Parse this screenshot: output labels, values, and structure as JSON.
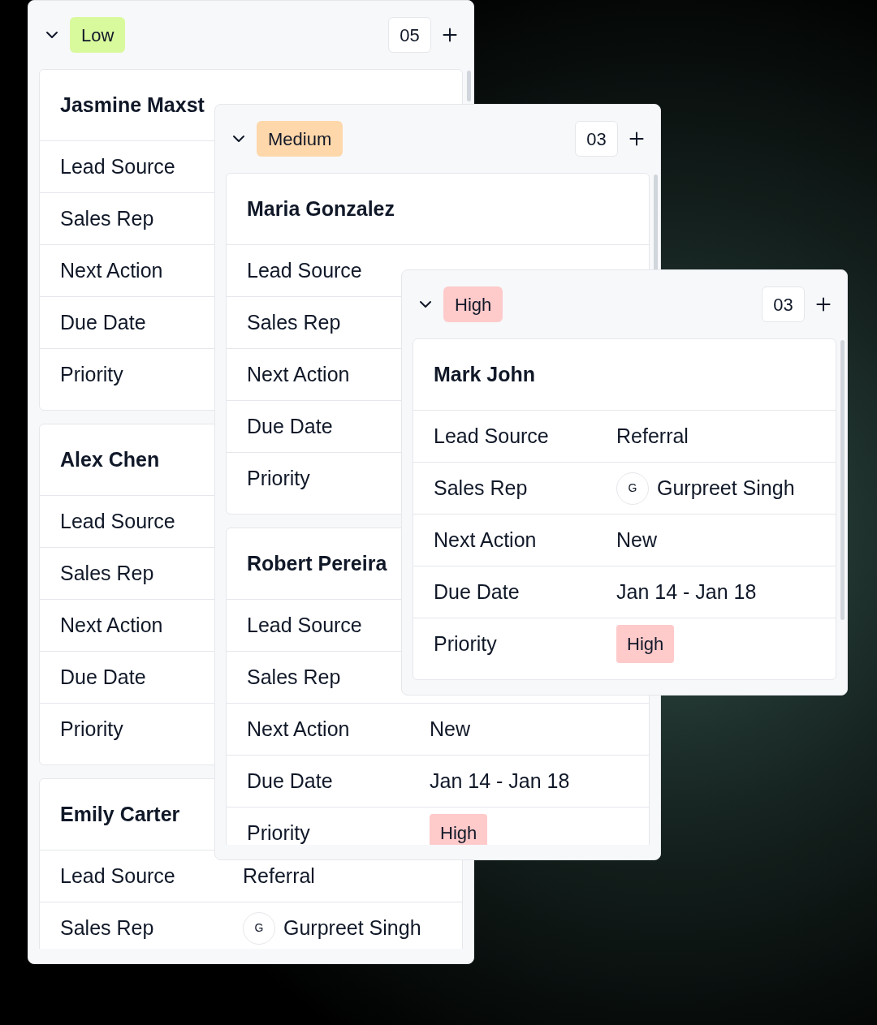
{
  "columns": [
    {
      "priority": "Low",
      "color": "#d9f99d",
      "expanded": true,
      "count": "05",
      "cards": [
        {
          "name": "Jasmine Maxst",
          "fields": [
            {
              "label": "Lead Source"
            },
            {
              "label": "Sales Rep"
            },
            {
              "label": "Next Action"
            },
            {
              "label": "Due Date"
            },
            {
              "label": "Priority"
            }
          ]
        },
        {
          "name": "Alex Chen",
          "fields": [
            {
              "label": "Lead Source"
            },
            {
              "label": "Sales Rep"
            },
            {
              "label": "Next Action"
            },
            {
              "label": "Due Date"
            },
            {
              "label": "Priority"
            }
          ]
        },
        {
          "name": "Emily Carter",
          "fields": [
            {
              "kind": "text",
              "label": "Lead Source",
              "value": "Referral"
            },
            {
              "kind": "person",
              "label": "Sales Rep",
              "initial": "G",
              "value": "Gurpreet Singh"
            }
          ]
        }
      ]
    },
    {
      "priority": "Medium",
      "color": "#fed7aa",
      "expanded": true,
      "count": "03",
      "cards": [
        {
          "name": "Maria Gonzalez",
          "fields": [
            {
              "label": "Lead Source"
            },
            {
              "label": "Sales Rep"
            },
            {
              "label": "Next Action"
            },
            {
              "label": "Due Date"
            },
            {
              "label": "Priority"
            }
          ]
        },
        {
          "name": "Robert Pereira",
          "fields": [
            {
              "label": "Lead Source"
            },
            {
              "label": "Sales Rep"
            },
            {
              "kind": "text",
              "label": "Next Action",
              "value": "New"
            },
            {
              "kind": "text",
              "label": "Due Date",
              "value": "Jan 14 - Jan 18"
            },
            {
              "kind": "tag",
              "label": "Priority",
              "value": "High",
              "color": "#fecaca"
            }
          ]
        }
      ]
    },
    {
      "priority": "High",
      "color": "#fecaca",
      "expanded": true,
      "count": "03",
      "cards": [
        {
          "name": "Mark John",
          "fields": [
            {
              "kind": "text",
              "label": "Lead Source",
              "value": "Referral"
            },
            {
              "kind": "person",
              "label": "Sales Rep",
              "initial": "G",
              "value": "Gurpreet Singh"
            },
            {
              "kind": "text",
              "label": "Next Action",
              "value": "New"
            },
            {
              "kind": "text",
              "label": "Due Date",
              "value": "Jan 14 - Jan 18"
            },
            {
              "kind": "tag",
              "label": "Priority",
              "value": "High",
              "color": "#fecaca"
            }
          ]
        }
      ]
    }
  ]
}
